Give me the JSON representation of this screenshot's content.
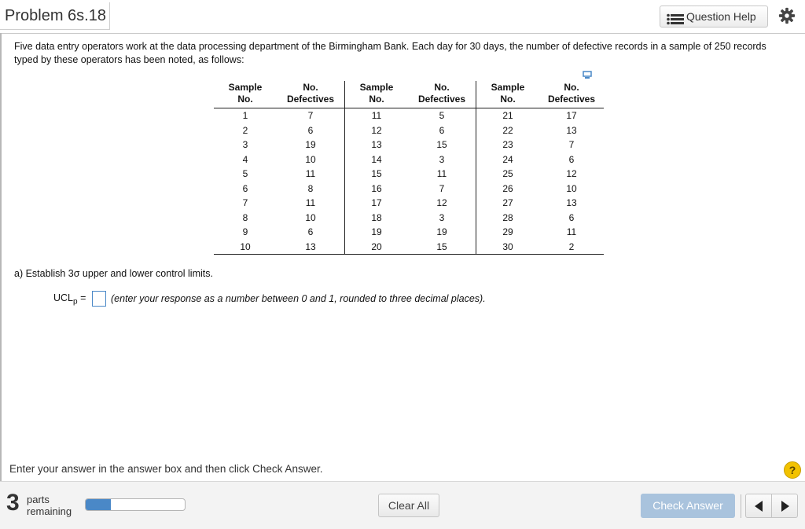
{
  "header": {
    "title": "Problem 6s.18",
    "question_help": "Question Help",
    "question_help_icon": "list-icon",
    "settings_icon": "gear-icon"
  },
  "problem": {
    "intro": "Five data entry operators work at the data processing department of the Birmingham Bank. Each day for 30 days, the number of defective records in a sample of 250 records typed by these operators has been noted, as follows:"
  },
  "table": {
    "headers": [
      [
        "Sample",
        "No."
      ],
      [
        "No.",
        "Defectives"
      ],
      [
        "Sample",
        "No."
      ],
      [
        "No.",
        "Defectives"
      ],
      [
        "Sample",
        "No."
      ],
      [
        "No.",
        "Defectives"
      ]
    ],
    "rows": [
      [
        "1",
        "7",
        "11",
        "5",
        "21",
        "17"
      ],
      [
        "2",
        "6",
        "12",
        "6",
        "22",
        "13"
      ],
      [
        "3",
        "19",
        "13",
        "15",
        "23",
        "7"
      ],
      [
        "4",
        "10",
        "14",
        "3",
        "24",
        "6"
      ],
      [
        "5",
        "11",
        "15",
        "11",
        "25",
        "12"
      ],
      [
        "6",
        "8",
        "16",
        "7",
        "26",
        "10"
      ],
      [
        "7",
        "11",
        "17",
        "12",
        "27",
        "13"
      ],
      [
        "8",
        "10",
        "18",
        "3",
        "28",
        "6"
      ],
      [
        "9",
        "6",
        "19",
        "19",
        "29",
        "11"
      ],
      [
        "10",
        "13",
        "20",
        "15",
        "30",
        "2"
      ]
    ]
  },
  "part_a": {
    "question": "a) Establish 3σ upper and lower control limits.",
    "ucl_label": "UCL",
    "ucl_sub": "p",
    "equals": "=",
    "ucl_value": "",
    "hint": "(enter your response as a number between 0 and 1, rounded to three decimal places)."
  },
  "instruction": "Enter your answer in the answer box and then click Check Answer.",
  "help_badge": "?",
  "footer": {
    "parts_count": "3",
    "parts_label_1": "parts",
    "parts_label_2": "remaining",
    "progress_fraction": 0.25,
    "clear_all": "Clear All",
    "check_answer": "Check Answer"
  },
  "colors": {
    "accent": "#4a88c7",
    "check_button": "#a9c3dd",
    "help_badge": "#f2c200"
  }
}
